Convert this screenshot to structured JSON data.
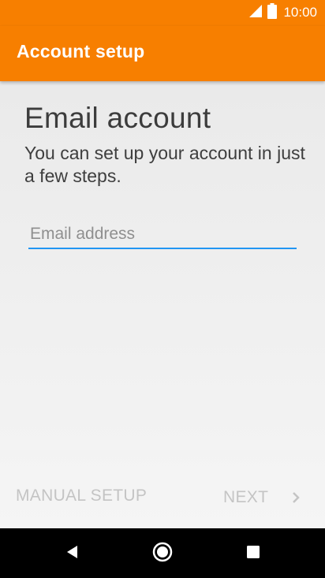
{
  "status_bar": {
    "time": "10:00",
    "icons": [
      "signal-icon",
      "battery-icon"
    ]
  },
  "app_bar": {
    "title": "Account setup"
  },
  "main": {
    "heading": "Email account",
    "description": "You can set up your account in just a few steps.",
    "email_field": {
      "placeholder": "Email address",
      "value": ""
    }
  },
  "footer": {
    "manual_setup_label": "MANUAL SETUP",
    "next_label": "NEXT"
  },
  "nav_bar": {
    "icons": [
      "back-icon",
      "home-icon",
      "recents-icon"
    ]
  },
  "colors": {
    "accent": "#f77f00",
    "field_underline": "#2196f3",
    "disabled_text": "#c4c4c4"
  }
}
